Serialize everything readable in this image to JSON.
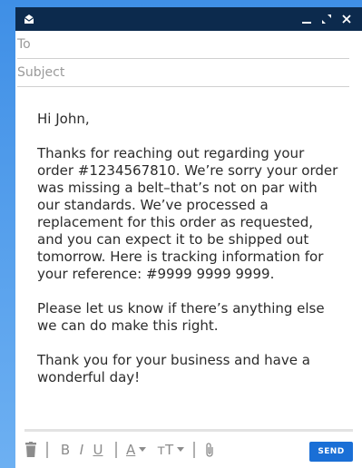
{
  "compose": {
    "to_placeholder": "To",
    "subject_placeholder": "Subject",
    "body": {
      "greeting": "Hi John,",
      "paragraph1": "Thanks for reaching out regarding your order #1234567810. We’re sorry your order was missing a belt–that’s not on par with our standards. We’ve processed a replacement for this order as requested, and you can expect it to be shipped out tomorrow. Here is tracking information for your reference: #9999 9999 9999.",
      "paragraph2": "Please let us know if there’s anything else we can do make this right.",
      "paragraph3": "Thank you for your business and have a wonderful day!"
    }
  },
  "toolbar": {
    "bold_label": "B",
    "italic_label": "I",
    "underline_label": "U",
    "font_color_label": "A",
    "font_size_label": "тT",
    "send_label": "SEND"
  },
  "colors": {
    "titlebar": "#0c2a4d",
    "send_button": "#1a6fd6",
    "background": "#3f8fe6"
  },
  "icons": [
    "mail-icon",
    "minimize-icon",
    "expand-icon",
    "close-icon",
    "trash-icon",
    "chevron-down-icon",
    "attachment-icon"
  ]
}
